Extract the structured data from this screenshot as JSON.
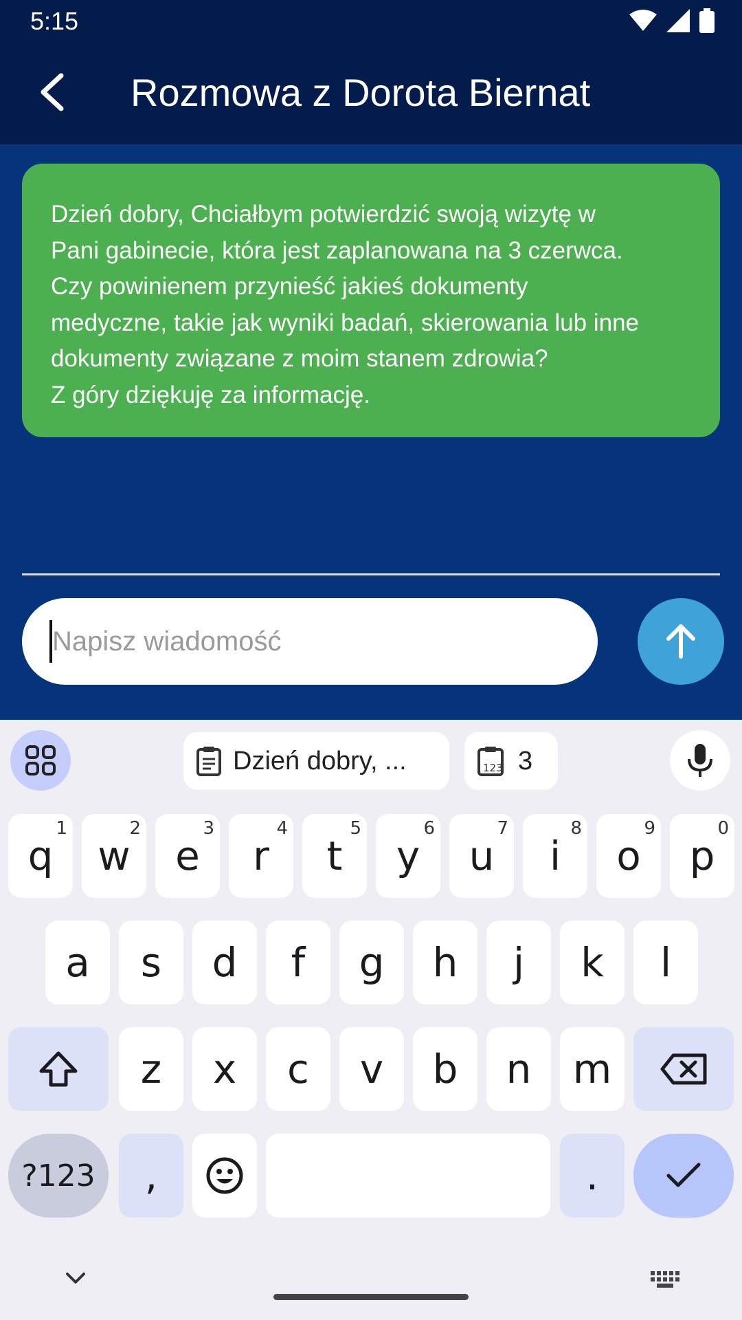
{
  "status_bar": {
    "time": "5:15"
  },
  "app_bar": {
    "title": "Rozmowa z Dorota Biernat"
  },
  "chat": {
    "messages": [
      {
        "text": "Dzień dobry, Chciałbym potwierdzić swoją wizytę w\nPani gabinecie, która jest zaplanowana na 3 czerwca.\nCzy powinienem przynieść jakieś dokumenty\nmedyczne, takie jak wyniki badań, skierowania lub inne\ndokumenty związane z moim stanem zdrowia?\nZ góry dziękuję za informację.",
        "color": "#4caf50"
      }
    ],
    "input_placeholder": "Napisz wiadomość"
  },
  "keyboard": {
    "suggestions": [
      "Dzień dobry, ...",
      "3"
    ],
    "row1": [
      {
        "key": "q",
        "hint": "1"
      },
      {
        "key": "w",
        "hint": "2"
      },
      {
        "key": "e",
        "hint": "3"
      },
      {
        "key": "r",
        "hint": "4"
      },
      {
        "key": "t",
        "hint": "5"
      },
      {
        "key": "y",
        "hint": "6"
      },
      {
        "key": "u",
        "hint": "7"
      },
      {
        "key": "i",
        "hint": "8"
      },
      {
        "key": "o",
        "hint": "9"
      },
      {
        "key": "p",
        "hint": "0"
      }
    ],
    "row2": [
      "a",
      "s",
      "d",
      "f",
      "g",
      "h",
      "j",
      "k",
      "l"
    ],
    "row3": [
      "z",
      "x",
      "c",
      "v",
      "b",
      "n",
      "m"
    ],
    "symbols_label": "?123",
    "comma": ",",
    "period": "."
  },
  "colors": {
    "header": "#041c4b",
    "background": "#05347a",
    "bubble": "#4caf50",
    "send": "#3fa3d8"
  }
}
